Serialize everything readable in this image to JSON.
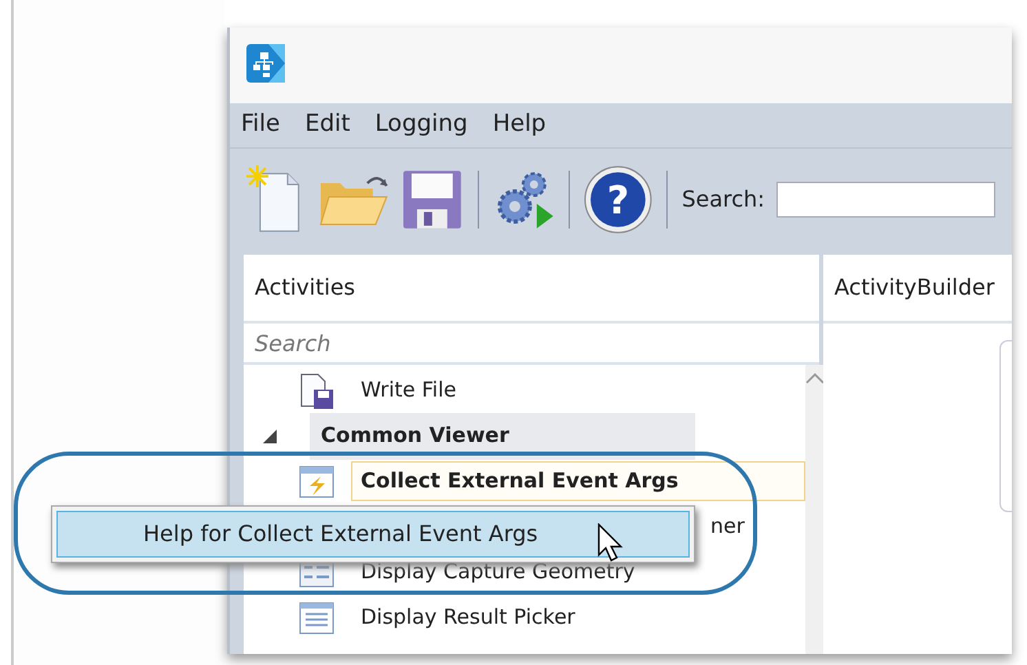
{
  "menu": [
    "File",
    "Edit",
    "Logging",
    "Help"
  ],
  "toolbar": {
    "help_glyph": "?",
    "search_label": "Search:"
  },
  "activities": {
    "title": "Activities",
    "search_placeholder": "Search",
    "items": [
      {
        "kind": "item",
        "label": "Write File",
        "selected": false
      },
      {
        "kind": "group",
        "label": "Common Viewer",
        "expanded": true
      },
      {
        "kind": "item",
        "label": "Collect External Event Args",
        "selected": true
      },
      {
        "kind": "item",
        "label": "ner",
        "selected": false
      },
      {
        "kind": "item",
        "label": "Display Capture Geometry",
        "selected": false
      },
      {
        "kind": "item",
        "label": "Display Result Picker",
        "selected": false
      }
    ]
  },
  "designer": {
    "title": "ActivityBuilder"
  },
  "context_menu": {
    "items": [
      {
        "label": "Help for Collect External Event Args",
        "selected": true
      }
    ]
  }
}
